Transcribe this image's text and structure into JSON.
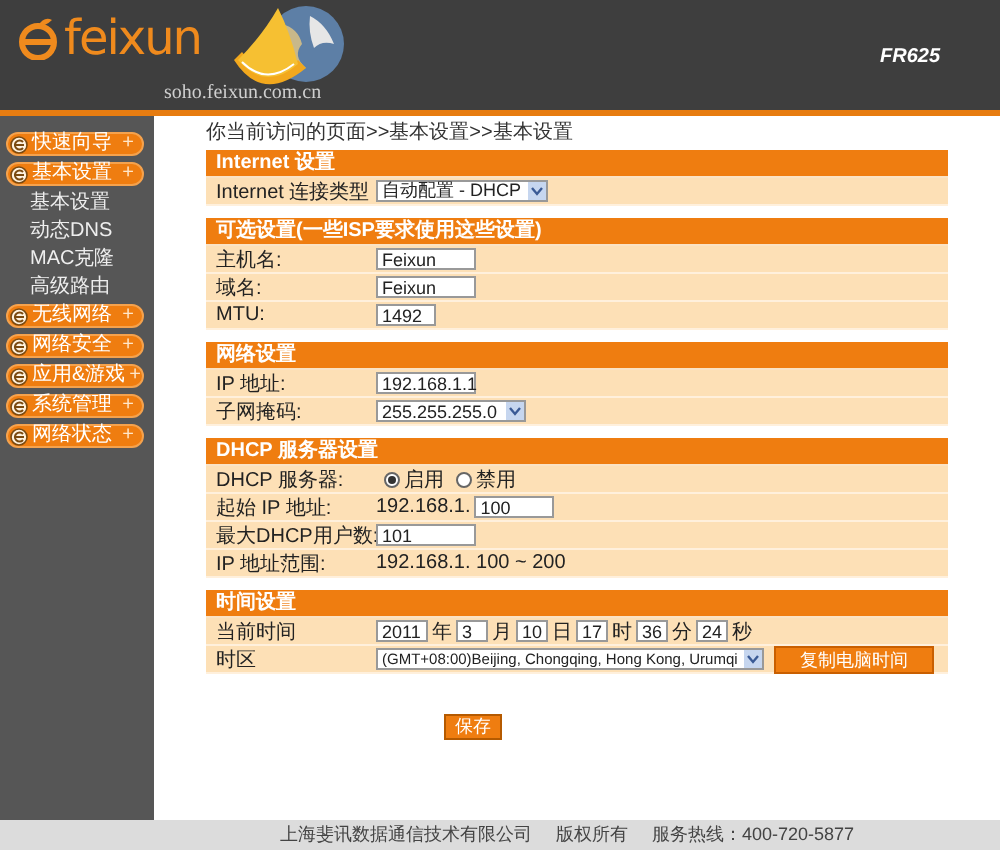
{
  "header": {
    "brand": "feixun",
    "url": "soho.feixun.com.cn",
    "model": "FR625"
  },
  "sidebar": {
    "items": [
      {
        "label": "快速向导",
        "toggle": "+"
      },
      {
        "label": "基本设置",
        "toggle": "+",
        "children": [
          {
            "label": "基本设置"
          },
          {
            "label": "动态DNS"
          },
          {
            "label": "MAC克隆"
          },
          {
            "label": "高级路由"
          }
        ]
      },
      {
        "label": "无线网络",
        "toggle": "+"
      },
      {
        "label": "网络安全",
        "toggle": "+"
      },
      {
        "label": "应用&游戏",
        "toggle": "+"
      },
      {
        "label": "系统管理",
        "toggle": "+"
      },
      {
        "label": "网络状态",
        "toggle": "+"
      }
    ]
  },
  "form": {
    "breadcrumb": "你当前访问的页面>>基本设置>>基本设置",
    "sections": [
      {
        "title": "Internet 设置",
        "rows": [
          {
            "kind": "select",
            "label": "Internet 连接类型",
            "value": "自动配置 - DHCP"
          }
        ]
      },
      {
        "title": "可选设置(一些ISP要求使用这些设置)",
        "rows": [
          {
            "kind": "text",
            "label": "主机名:",
            "value": "Feixun"
          },
          {
            "kind": "text",
            "label": "域名:",
            "value": "Feixun"
          },
          {
            "kind": "short",
            "label": "MTU:",
            "value": "1492"
          }
        ]
      },
      {
        "title": "网络设置",
        "rows": [
          {
            "kind": "text",
            "label": "IP 地址:",
            "value": "192.168.1.1"
          },
          {
            "kind": "select",
            "label": "子网掩码:",
            "value": "255.255.255.0"
          }
        ]
      },
      {
        "title": "DHCP 服务器设置",
        "rows": [
          {
            "kind": "radio",
            "label": "DHCP 服务器:",
            "options": [
              {
                "label": "启用",
                "selected": true
              },
              {
                "label": "禁用",
                "selected": false
              }
            ]
          },
          {
            "kind": "prefixed",
            "label": "起始 IP 地址:",
            "prefix": "192.168.1.",
            "value": "100"
          },
          {
            "kind": "text",
            "label": "最大DHCP用户数:",
            "value": "101"
          },
          {
            "kind": "static",
            "label": "IP 地址范围:",
            "value": "192.168.1. 100 ~ 200"
          }
        ]
      },
      {
        "title": "时间设置",
        "rows": [
          {
            "kind": "datetime",
            "label": "当前时间",
            "parts": [
              {
                "value": "2011",
                "unit": "年"
              },
              {
                "value": "3",
                "unit": "月"
              },
              {
                "value": "10",
                "unit": "日"
              },
              {
                "value": "17",
                "unit": "时"
              },
              {
                "value": "36",
                "unit": "分"
              },
              {
                "value": "24",
                "unit": "秒"
              }
            ]
          },
          {
            "kind": "timezone",
            "label": "时区",
            "value": "(GMT+08:00)Beijing, Chongqing, Hong Kong, Urumqi",
            "button": "复制电脑时间"
          }
        ]
      }
    ],
    "buttons": [
      "保存"
    ]
  },
  "footer": [
    "上海斐讯数据通信技术有限公司",
    "版权所有",
    "服务热线：400-720-5877"
  ]
}
